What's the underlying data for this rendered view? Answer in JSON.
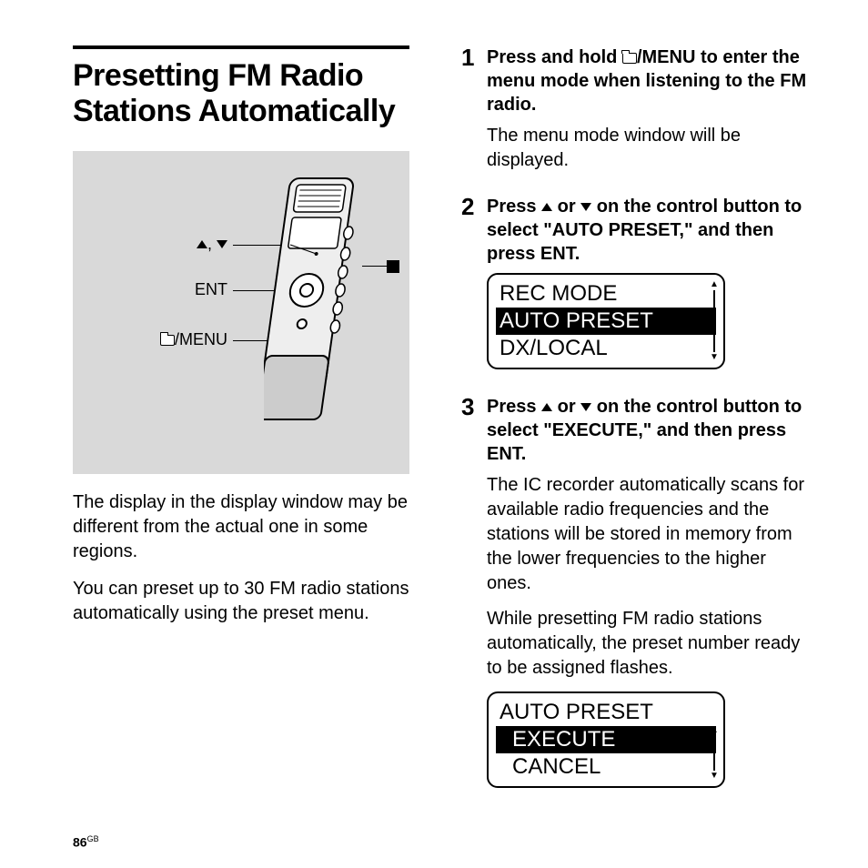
{
  "title": "Presetting FM Radio Stations Automatically",
  "diagram_labels": {
    "updown": ",",
    "ent": "ENT",
    "menu": "/MENU"
  },
  "intro1": "The display in the display window may be different from the actual one in some regions.",
  "intro2": "You can preset up to 30 FM radio stations automatically using the preset menu.",
  "steps": [
    {
      "num": "1",
      "head_pre": "Press and hold ",
      "head_post": "/MENU to enter the menu mode when listening to the FM radio.",
      "text": "The menu mode window will be displayed."
    },
    {
      "num": "2",
      "head_pre": "Press ",
      "head_mid": " or ",
      "head_post": " on the control button to select \"AUTO PRESET,\" and then press ENT.",
      "lcd": {
        "rows": [
          "REC MODE",
          "AUTO PRESET",
          "DX/LOCAL"
        ],
        "selected": 1
      }
    },
    {
      "num": "3",
      "head_pre": "Press ",
      "head_mid": " or ",
      "head_post": " on the control button to select \"EXECUTE,\" and then press ENT.",
      "text1": "The IC recorder automatically scans for available radio frequencies and the stations will be stored in memory from the lower frequencies to the higher ones.",
      "text2": "While presetting FM radio stations automatically, the preset number ready to be assigned flashes.",
      "lcd": {
        "title": "AUTO PRESET",
        "rows": [
          "EXECUTE",
          "CANCEL"
        ],
        "selected": 0
      }
    }
  ],
  "page": "86",
  "page_region": "GB"
}
